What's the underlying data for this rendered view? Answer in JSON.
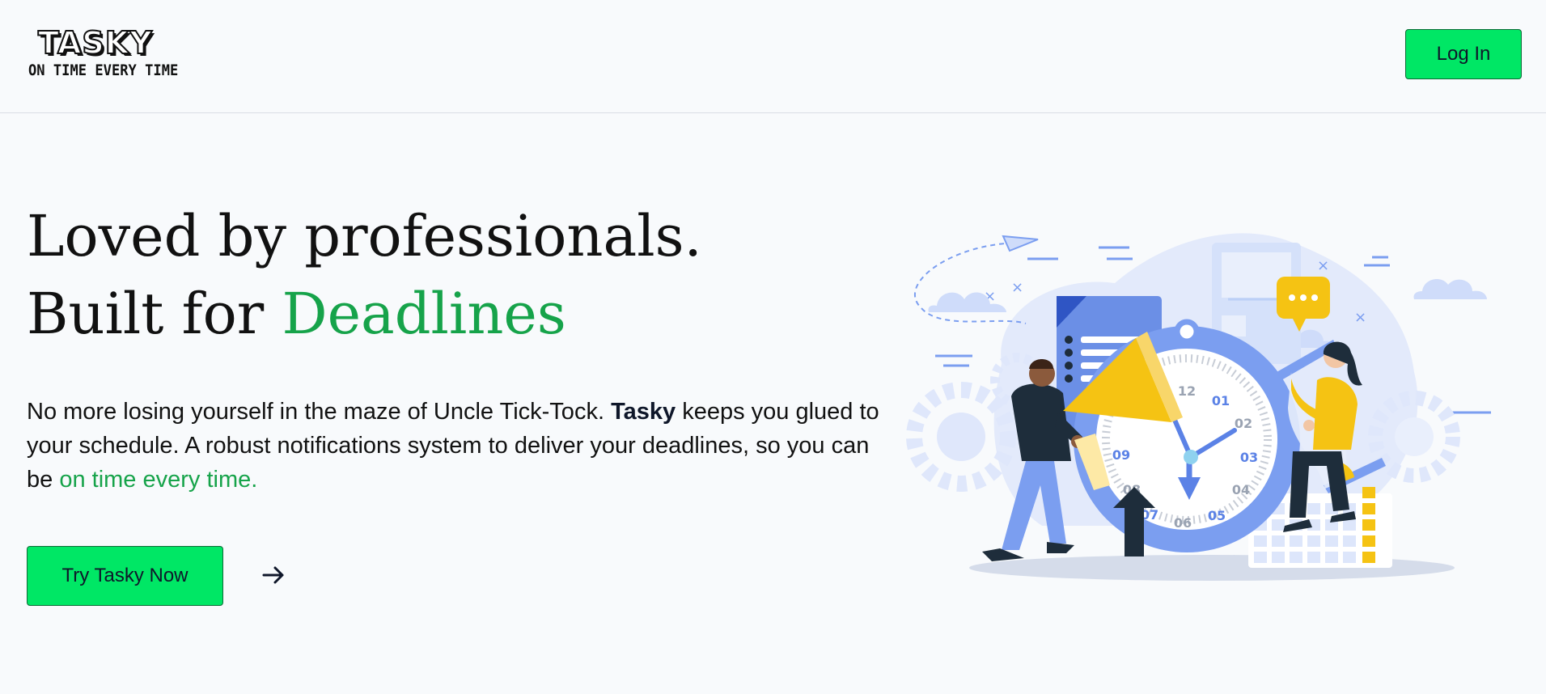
{
  "header": {
    "logo_word": "TASKY",
    "logo_tagline": "ON TIME EVERY TIME",
    "login_label": "Log In"
  },
  "hero": {
    "headline_line1": "Loved by professionals.",
    "headline_line2_prefix": "Built for ",
    "headline_line2_accent": "Deadlines",
    "description_part1": "No more losing yourself in the maze of Uncle Tick-Tock. ",
    "description_brand": "Tasky",
    "description_part2": " keeps you glued to your schedule. A robust notifications system to deliver your deadlines, so you can be ",
    "description_accent": "on time every time.",
    "cta_label": "Try Tasky Now",
    "cta_arrow_icon": "arrow-right-icon"
  },
  "illustration": {
    "name": "clock-deadline-illustration",
    "clock_numbers": [
      "12",
      "01",
      "02",
      "03",
      "04",
      "05",
      "06",
      "07",
      "08",
      "09"
    ],
    "colors": {
      "blue": "#7b9ef0",
      "light_blue": "#dde6fb",
      "yellow": "#f5c313",
      "dark": "#1e2d3b"
    }
  },
  "colors": {
    "accent_green": "#16a34a",
    "button_green": "#00e765",
    "background": "#f8fafc"
  }
}
